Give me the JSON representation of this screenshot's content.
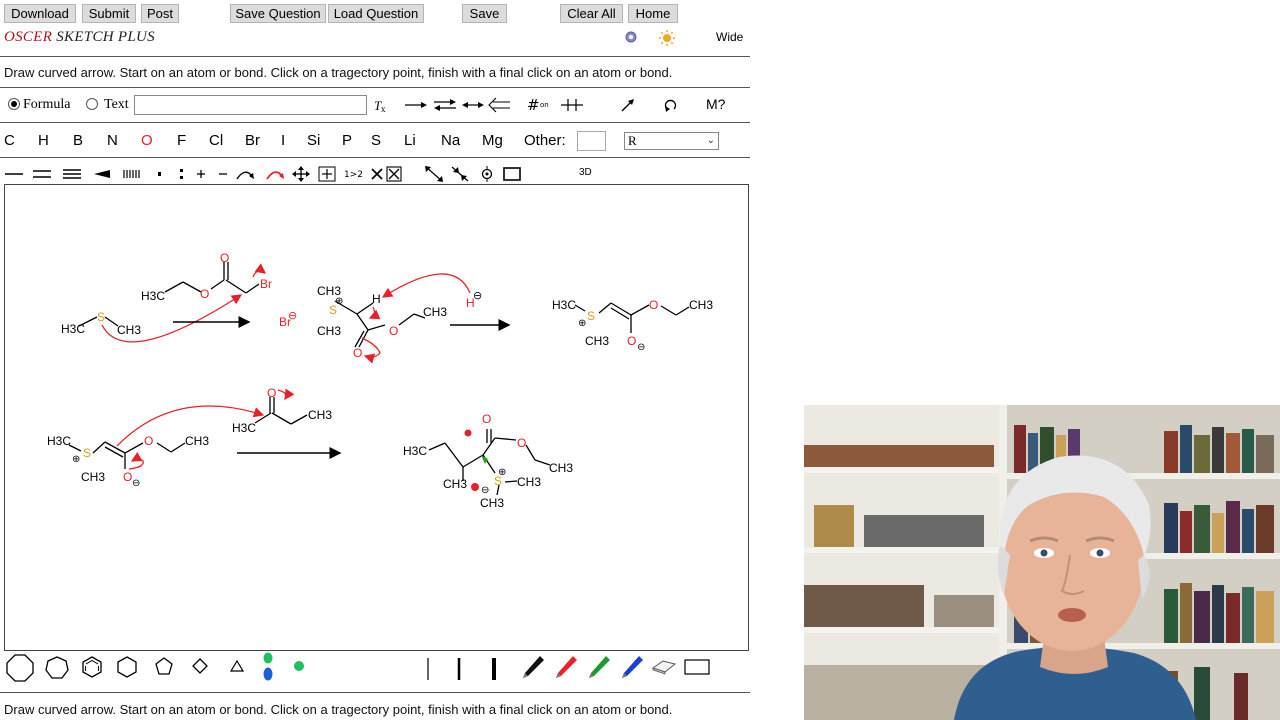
{
  "toolbar": {
    "download": "Download",
    "submit": "Submit",
    "post": "Post",
    "save_question": "Save Question",
    "load_question": "Load Question",
    "save": "Save",
    "clear_all": "Clear All",
    "home": "Home"
  },
  "brand": {
    "oscer": "OSCER",
    "sketch": "SKETCH PLUS"
  },
  "wide_label": "Wide",
  "status_message": "Draw curved arrow. Start on an atom or bond. Click on a tragectory point, finish with a final click on an atom or bond.",
  "input_mode": {
    "formula": "Formula",
    "text": "Text",
    "text_value": ""
  },
  "formula_tools": [
    "text-format",
    "single-arrow",
    "equilibrium-arrow",
    "resonance-arrow",
    "retro-arrow",
    "hash-tool",
    "bond-break",
    "pen-arrow",
    "rotate-tool"
  ],
  "help_label": "M?",
  "elements": [
    "C",
    "H",
    "B",
    "N",
    "O",
    "F",
    "Cl",
    "Br",
    "I",
    "Si",
    "P",
    "S",
    "Li",
    "Na",
    "Mg"
  ],
  "selected_element": "O",
  "other_label": "Other:",
  "other_value": "",
  "rgroup_select": "R",
  "bond_tools": [
    "single-bond",
    "double-bond",
    "triple-bond",
    "wedge-bond",
    "hash-bond",
    "dot",
    "two-dots",
    "plus-charge",
    "minus-charge",
    "single-curved-arrow",
    "double-curved-arrow",
    "move",
    "select",
    "numbering",
    "delete",
    "delete-box",
    "expand",
    "contract",
    "center",
    "rectangle"
  ],
  "three_d_label": "3D",
  "colors": {
    "accent_red": "#e8202a",
    "heteroatom_red": "#e8202a",
    "sulfur": "#d4a017",
    "black": "#000000"
  },
  "molecules": {
    "r1_ester": {
      "h3c": "H3C",
      "o_top": "O",
      "o_ester": "O",
      "br": "Br"
    },
    "r1_sulfide": {
      "h3c": "H3C",
      "s": "S",
      "ch3": "CH3"
    },
    "r1_bromide": {
      "br": "Br",
      "charge": "⊖"
    },
    "r1_ylide_salt": {
      "ch3_top": "CH3",
      "plus": "⊕",
      "s": "S",
      "h": "H",
      "ch3_bot": "CH3",
      "o_ester": "O",
      "ch3_end": "CH3",
      "o_carbonyl": "O"
    },
    "r1_hydride": {
      "h": "H",
      "minus": "⊖"
    },
    "r1_enolate": {
      "h3c": "H3C",
      "plus": "⊕",
      "s": "S",
      "ch3": "CH3",
      "o_ester": "O",
      "ch3_end": "CH3",
      "o_minus": "O",
      "minus": "⊖"
    },
    "r2_enolate": {
      "h3c": "H3C",
      "plus": "⊕",
      "s": "S",
      "ch3": "CH3",
      "o_ester": "O",
      "ch3_end": "CH3",
      "o_minus": "O",
      "minus": "⊖"
    },
    "r2_ketone": {
      "o": "O",
      "h3c": "H3C",
      "ch3": "CH3"
    },
    "r2_product": {
      "h3c": "H3C",
      "o_carbonyl": "O",
      "o_ester": "O",
      "ch3_end": "CH3",
      "ch3_low": "CH3",
      "plus": "⊕",
      "s": "S",
      "s_ch3": "CH3",
      "s_ch3_bot": "CH3",
      "minus": "⊖"
    }
  },
  "shape_tools": [
    "octagon-ring",
    "heptagon-ring",
    "benzene-ring",
    "hexagon-ring",
    "pentagon-ring",
    "square-ring",
    "triangle-ring",
    "chain-tool",
    "green-dot"
  ],
  "draw_tools": [
    "thin-line",
    "medium-line",
    "thick-line",
    "black-pen",
    "red-pen",
    "green-pen",
    "blue-pen",
    "eraser",
    "rectangle-tool"
  ],
  "webcam": {
    "description_label": "presenter-webcam"
  }
}
